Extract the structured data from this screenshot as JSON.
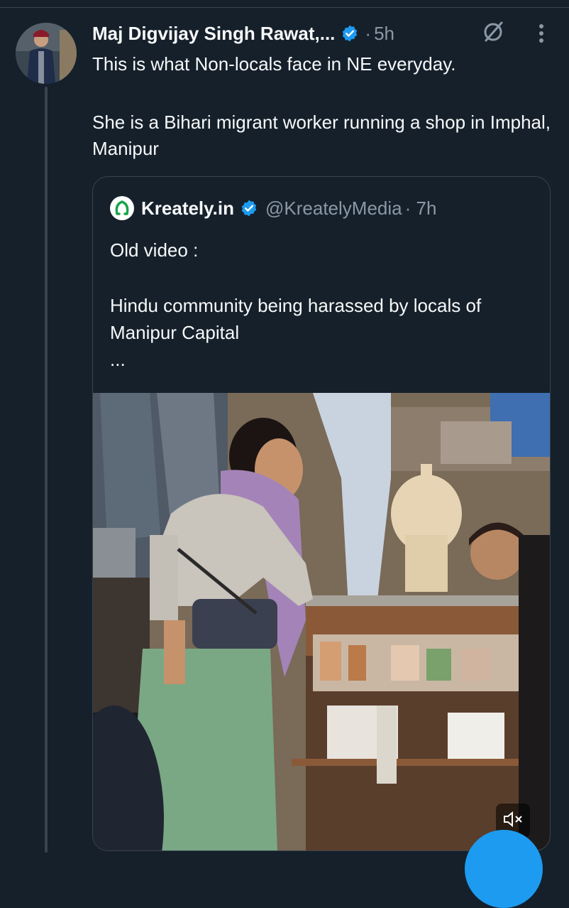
{
  "tweet": {
    "author_name": "Maj Digvijay Singh Rawat,...",
    "separator": "·",
    "time": "5h",
    "lines": [
      "This is what Non-locals face in NE everyday.",
      "She is a Bihari migrant worker running a shop in Imphal, Manipur"
    ]
  },
  "quote": {
    "name": "Kreately.in",
    "handle": "@KreatelyMedia",
    "separator": "·",
    "time": "7h",
    "lines": [
      "Old video :",
      "Hindu community being harassed by locals of Manipur Capital",
      "..."
    ]
  },
  "icons": {
    "verified": "verified-badge-icon",
    "grok": "grok-icon",
    "more": "more-options-icon",
    "mute": "mute-speaker-icon",
    "logo": "kreately-logo-icon"
  },
  "colors": {
    "background": "#15202b",
    "accent": "#1d9bf0",
    "secondary_text": "#8b98a5",
    "border": "#38444d"
  }
}
